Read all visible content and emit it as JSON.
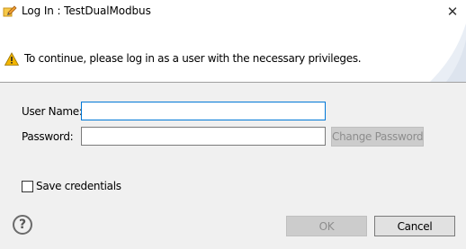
{
  "window": {
    "title": "Log In  : TestDualModbus",
    "app_icon": "pencil-app-icon",
    "close_label": "✕"
  },
  "header": {
    "message": "To continue, please log in as a user with the necessary privileges.",
    "icon": "warning-icon"
  },
  "form": {
    "username_label": "User Name:",
    "username_value": "",
    "password_label": "Password:",
    "password_value": "",
    "change_password_label": "Change Password",
    "save_credentials_label": "Save credentials",
    "save_credentials_checked": false
  },
  "footer": {
    "help_label": "?",
    "ok_label": "OK",
    "cancel_label": "Cancel"
  },
  "colors": {
    "focus_border": "#0078d7",
    "warning": "#f2b500"
  }
}
